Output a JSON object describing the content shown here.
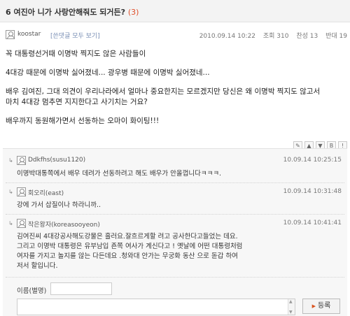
{
  "post": {
    "title": "6 여진아 니가 사랑안해줘도 되거든?",
    "comment_count": "(3)",
    "author": "koostar",
    "view_all_comments": "[쓴댓글 모두 보기]",
    "date": "2010.09.14 10:22",
    "views": "조회 310",
    "likes": "찬성 13",
    "dislikes": "반대 19",
    "body": [
      "꼭 대통령선거때 이명박 찍지도 않은 사람들이",
      "4대강 때문에 이명박 싫어졌네... 광우병 때문에 이명박 싫어졌네...",
      "배우 김여진, 그대 의견이 우리나라에서 얼마나 중요한지는 모르겠지만 당신은 왜 이명박 찍지도 않고서",
      "마치 4대강 멈추면 지지한다고 사기치는 거요?",
      "배우까지 동원해가면서 선동하는 오마이 화이팅!!!"
    ]
  },
  "tools": [
    {
      "icon": "pencil-icon",
      "glyph": "✎"
    },
    {
      "icon": "thumbs-up-icon",
      "glyph": "▲"
    },
    {
      "icon": "thumbs-down-icon",
      "glyph": "▼"
    },
    {
      "icon": "bookmark-icon",
      "glyph": "B"
    },
    {
      "icon": "alert-icon",
      "glyph": "!"
    }
  ],
  "comments": [
    {
      "author": "Ddkfhs(susu1120)",
      "date": "10.09.14 10:25:15",
      "lines": [
        "이명박대통쪽에서 배우 데려가 선동하려고 해도 배우가 안올껍니다ㅋㅋㅋ."
      ]
    },
    {
      "author": "회오리(east)",
      "date": "10.09.14 10:31:48",
      "lines": [
        "강에 가서 삽질이나 하라니까.."
      ]
    },
    {
      "author": "작은왕자(koreasooyeon)",
      "date": "10.09.14 10:41:41",
      "lines": [
        "김여진씨 4대강공사해도강물은 흘러요.잘흐르게할 려고 공사한다고들었는 데요.",
        "그리고 이명박 대통령은 유부남입 죤쪽 여사가 계신다고 ! 옛날에 어떤 대통령처럼",
        "여자를 가지고 놀지를 않는 다든데요 .청와대 안가는 무궁화 동산 으로 돋갑 하여",
        "저서 할입니다."
      ]
    }
  ],
  "form": {
    "name_label": "이름(별명)",
    "name_value": "",
    "comment_value": "",
    "submit_label": "등록"
  }
}
